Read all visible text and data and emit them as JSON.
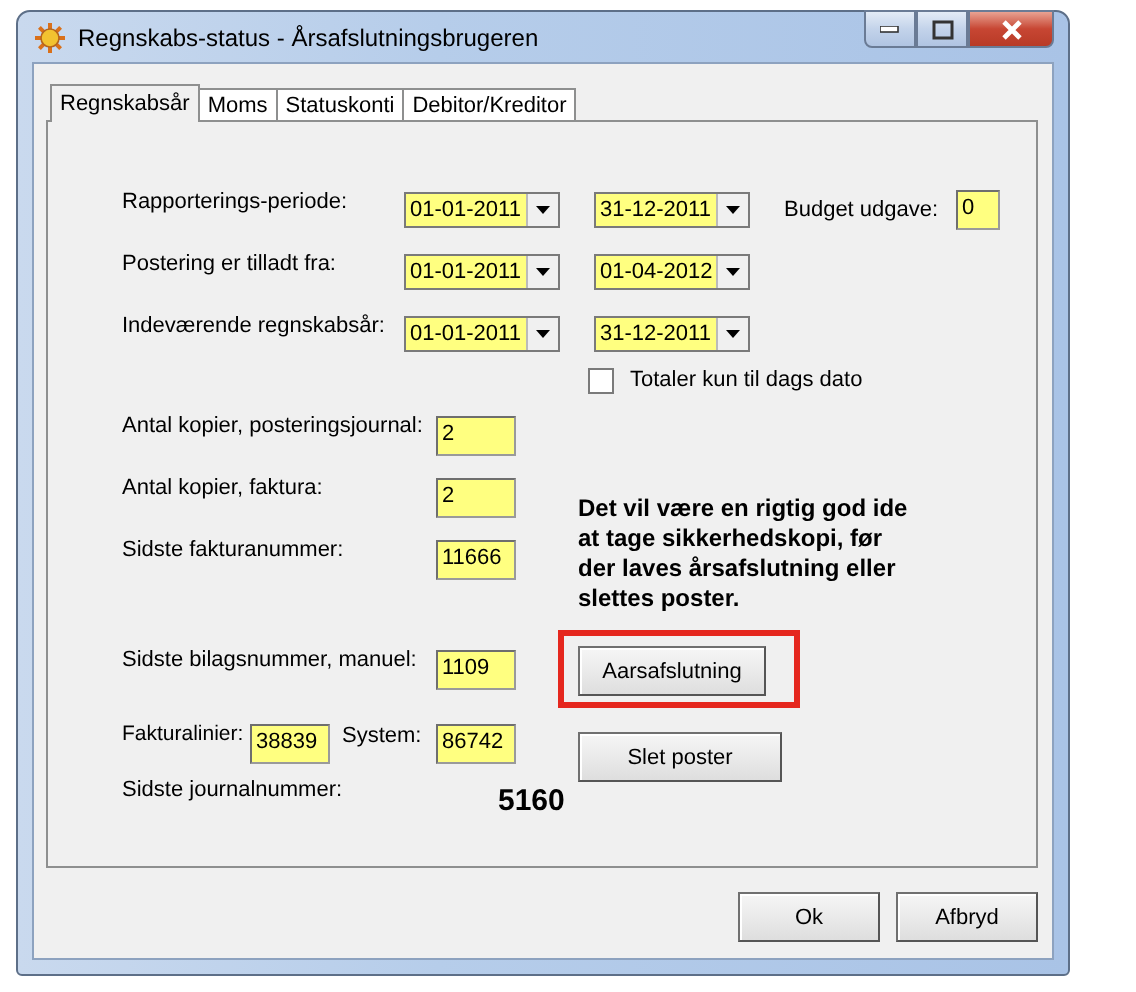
{
  "window": {
    "title": "Regnskabs-status - Årsafslutningsbrugeren"
  },
  "tabs": [
    {
      "label": "Regnskabsår",
      "selected": true
    },
    {
      "label": "Moms",
      "selected": false
    },
    {
      "label": "Statuskonti",
      "selected": false
    },
    {
      "label": "Debitor/Kreditor",
      "selected": false
    }
  ],
  "period_rows": [
    {
      "label": "Rapporterings-periode:",
      "from": "01-01-2011",
      "to": "31-12-2011"
    },
    {
      "label": "Postering er tilladt fra:",
      "from": "01-01-2011",
      "to": "01-04-2012"
    },
    {
      "label": "Indeværende regnskabsår:",
      "from": "01-01-2011",
      "to": "31-12-2011"
    }
  ],
  "budget": {
    "label": "Budget udgave:",
    "value": "0"
  },
  "totals_checkbox": {
    "label": "Totaler kun til dags dato",
    "checked": false
  },
  "fields": [
    {
      "label": "Antal kopier, posteringsjournal:",
      "value": "2"
    },
    {
      "label": "Antal kopier, faktura:",
      "value": "2"
    },
    {
      "label": "Sidste fakturanummer:",
      "value": "11666"
    }
  ],
  "manual_voucher": {
    "label": "Sidste bilagsnummer, manuel:",
    "value": "1109"
  },
  "invoice_lines": {
    "label": "Fakturalinier:",
    "value": "38839",
    "system_label": "System:",
    "system_value": "86742"
  },
  "journal": {
    "label": "Sidste journalnummer:",
    "value": "5160"
  },
  "notice": "Det vil være en rigtig god ide at tage sikkerhedskopi, før der laves årsafslutning eller slettes poster.",
  "actions": [
    {
      "label": "Aarsafslutning",
      "highlighted": true
    },
    {
      "label": "Slet poster",
      "highlighted": false
    }
  ],
  "footer_buttons": [
    "Ok",
    "Afbryd"
  ]
}
